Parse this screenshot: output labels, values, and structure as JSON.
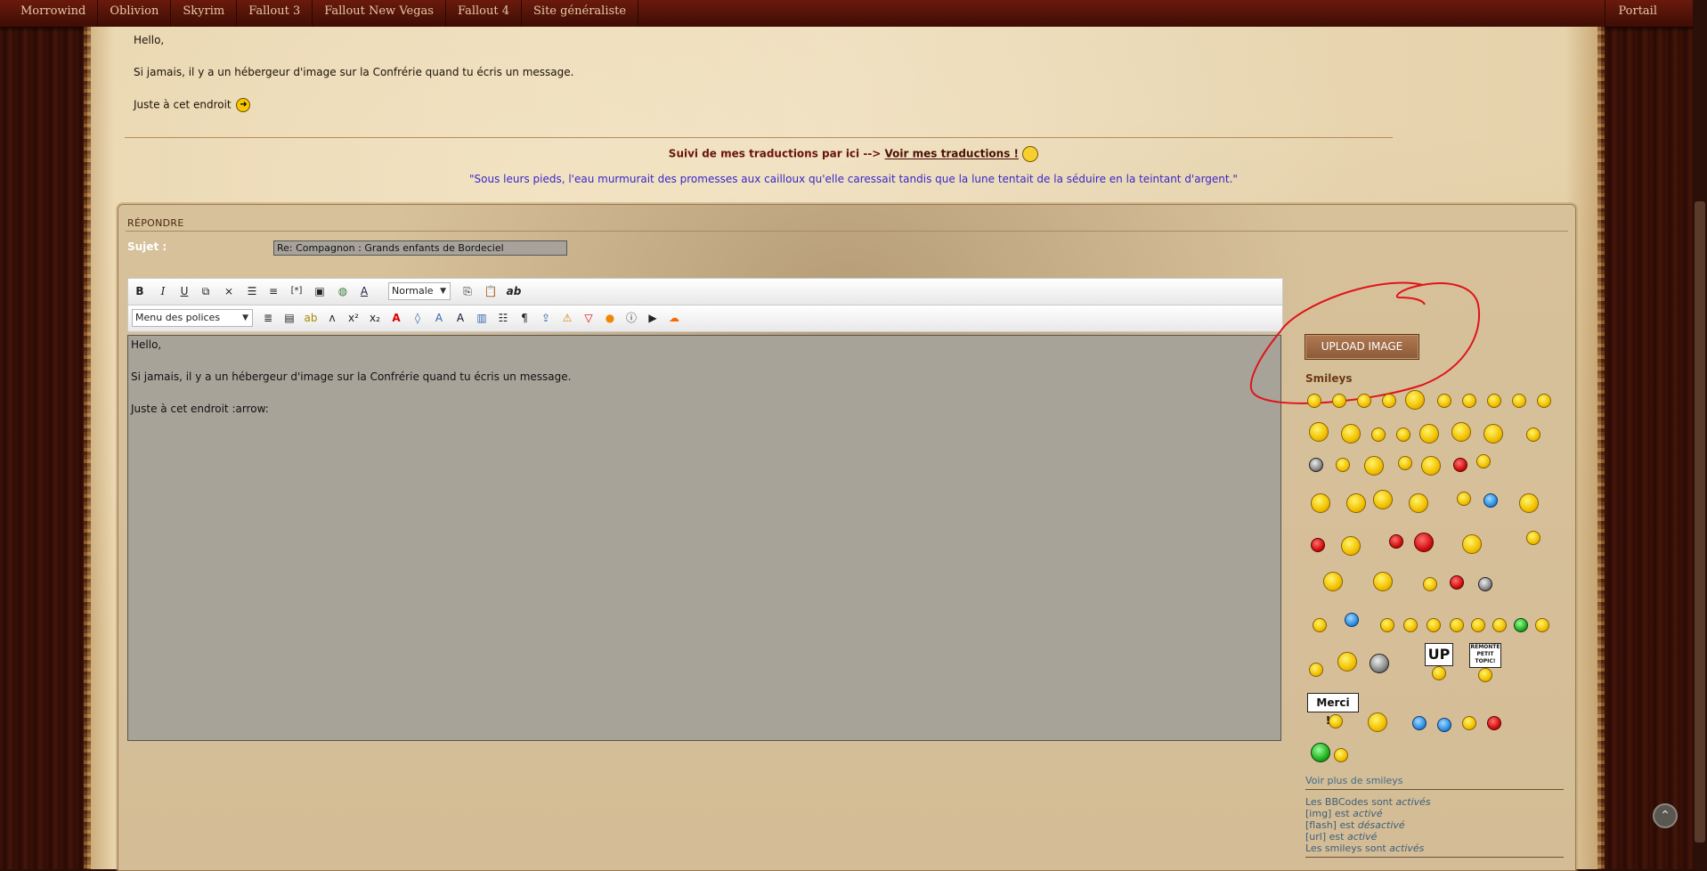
{
  "nav": {
    "items": [
      "Morrowind",
      "Oblivion",
      "Skyrim",
      "Fallout 3",
      "Fallout New Vegas",
      "Fallout 4",
      "Site généraliste"
    ],
    "portal": "Portail"
  },
  "post": {
    "line1": "Hello,",
    "line2": "Si jamais, il y a un hébergeur d'image sur la Confrérie quand tu écris un message.",
    "line3": "Juste à cet endroit",
    "arrow_glyph": "➜"
  },
  "signature": {
    "prefix": "Suivi de mes traductions par ici --> ",
    "link": "Voir mes traductions !",
    "quote": "\"Sous leurs pieds, l'eau murmurait des promesses aux cailloux qu'elle caressait tandis que la lune tentait de la séduire en la teintant d'argent.\""
  },
  "reply": {
    "header": "RÉPONDRE",
    "subject_label": "Sujet :",
    "subject_value": "Re: Compagnon : Grands enfants de Bordeciel",
    "size_select": "Normale",
    "font_select": "Menu des polices",
    "editor": {
      "line1": "Hello,",
      "line2": "Si jamais, il y a un hébergeur d'image sur la Confrérie quand tu écris un message.",
      "line3": "Juste à cet endroit :arrow:"
    }
  },
  "sidebar": {
    "upload_label": "UPLOAD IMAGE",
    "smileys_title": "Smileys",
    "sign_up": "UP",
    "sign_topic": "REMONTE PETIT TOPIC!",
    "sign_merci": "Merci !!!",
    "more_smileys": "Voir plus de smileys",
    "bbcodes_pre": "Les BBCodes sont ",
    "bbcodes_state": "activés",
    "img_pre": "[img] est ",
    "img_state": "activé",
    "flash_pre": "[flash] est ",
    "flash_state": "désactivé",
    "url_pre": "[url] est ",
    "url_state": "activé",
    "smileys_pre": "Les smileys sont ",
    "smileys_state": "activés"
  },
  "colors": {
    "annotation": "#e0141a",
    "upload_button": "#9a6844",
    "nav_bg": "#4e1208"
  }
}
